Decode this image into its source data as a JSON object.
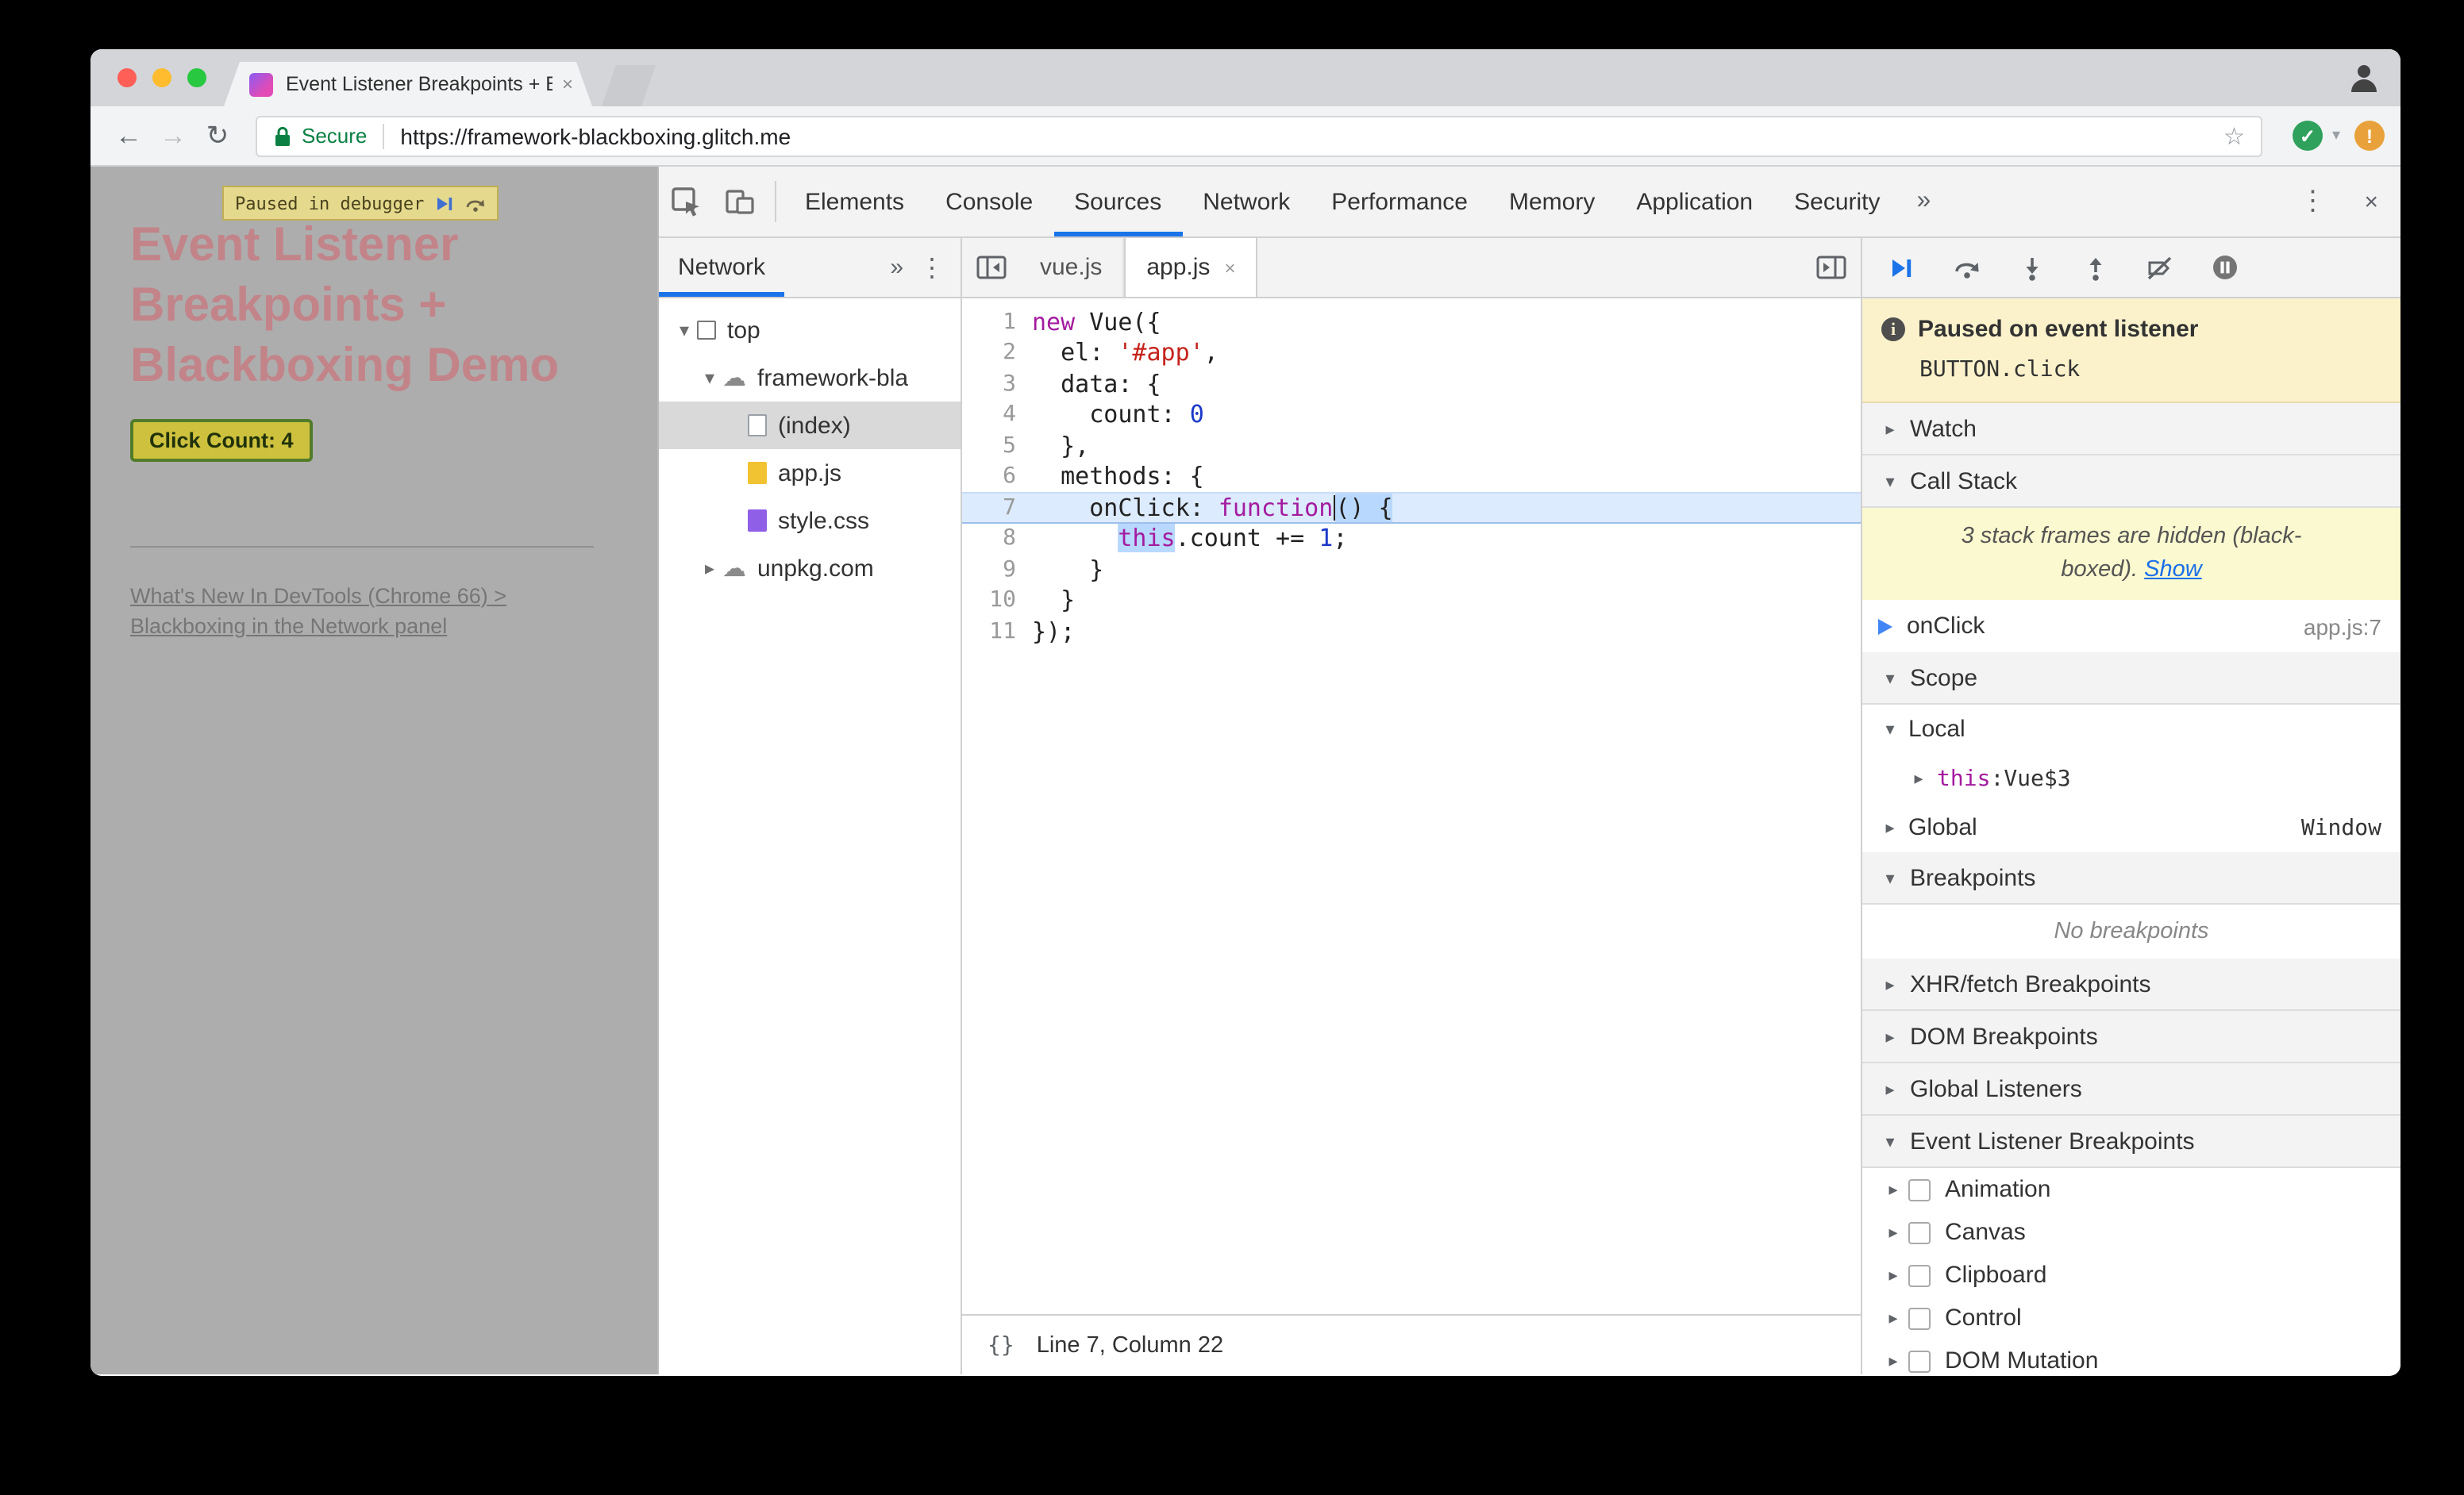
{
  "icons": {
    "back": "←",
    "forward": "→",
    "reload": "↻",
    "star": "☆",
    "kebab": "⋮",
    "close": "×",
    "overflow": "»",
    "tab_close": "×",
    "pretty_print": "{}",
    "cloud": "☁",
    "tri_down": "▾",
    "tri_right": "▸",
    "green_badge": "✓",
    "orange_badge": "!",
    "chevron_down": "▾"
  },
  "browser": {
    "tab_title": "Event Listener Breakpoints + B",
    "secure_label": "Secure",
    "url": "https://framework-blackboxing.glitch.me"
  },
  "page": {
    "paused_banner": "Paused in debugger",
    "heading_lines": [
      "Event Listener",
      "Breakpoints +",
      "Blackboxing Demo"
    ],
    "click_button": "Click Count: 4",
    "link_line1": "What's New In DevTools (Chrome 66) >",
    "link_line2": "Blackboxing in the Network panel"
  },
  "devtools": {
    "tabs": [
      "Elements",
      "Console",
      "Sources",
      "Network",
      "Performance",
      "Memory",
      "Application",
      "Security"
    ],
    "active_tab": "Sources",
    "navigator": {
      "active_tab": "Network",
      "tree": [
        {
          "label": "top",
          "icon": "frame",
          "depth": 0,
          "expander": "down"
        },
        {
          "label": "framework-bla",
          "icon": "cloud",
          "depth": 1,
          "expander": "down"
        },
        {
          "label": "(index)",
          "icon": "doc",
          "depth": 2,
          "expander": null,
          "selected": true
        },
        {
          "label": "app.js",
          "icon": "js",
          "depth": 2,
          "expander": null
        },
        {
          "label": "style.css",
          "icon": "css",
          "depth": 2,
          "expander": null
        },
        {
          "label": "unpkg.com",
          "icon": "cloud",
          "depth": 1,
          "expander": "right"
        }
      ]
    },
    "editor": {
      "tabs": [
        {
          "label": "vue.js",
          "active": false,
          "closable": false
        },
        {
          "label": "app.js",
          "active": true,
          "closable": true
        }
      ],
      "status": "Line 7, Column 22",
      "lines": [
        {
          "n": 1,
          "segs": [
            {
              "t": "new ",
              "c": "kw"
            },
            {
              "t": "Vue({",
              "c": "pln"
            }
          ]
        },
        {
          "n": 2,
          "segs": [
            {
              "t": "  el: ",
              "c": "pln"
            },
            {
              "t": "'#app'",
              "c": "str"
            },
            {
              "t": ",",
              "c": "pln"
            }
          ]
        },
        {
          "n": 3,
          "segs": [
            {
              "t": "  data: {",
              "c": "pln"
            }
          ]
        },
        {
          "n": 4,
          "segs": [
            {
              "t": "    count: ",
              "c": "pln"
            },
            {
              "t": "0",
              "c": "num"
            }
          ]
        },
        {
          "n": 5,
          "segs": [
            {
              "t": "  },",
              "c": "pln"
            }
          ]
        },
        {
          "n": 6,
          "segs": [
            {
              "t": "  methods: {",
              "c": "pln"
            }
          ]
        },
        {
          "n": 7,
          "exec": true,
          "segs": [
            {
              "t": "    onClick: ",
              "c": "pln"
            },
            {
              "t": "function",
              "c": "kw"
            },
            {
              "t": "",
              "c": "caret"
            },
            {
              "t": "() {",
              "c": "pln",
              "sel": true
            }
          ]
        },
        {
          "n": 8,
          "segs": [
            {
              "t": "      ",
              "c": "pln"
            },
            {
              "t": "this",
              "c": "kw",
              "sel": true
            },
            {
              "t": ".count += ",
              "c": "pln"
            },
            {
              "t": "1",
              "c": "num"
            },
            {
              "t": ";",
              "c": "pln"
            }
          ]
        },
        {
          "n": 9,
          "segs": [
            {
              "t": "    }",
              "c": "pln"
            }
          ]
        },
        {
          "n": 10,
          "segs": [
            {
              "t": "  }",
              "c": "pln"
            }
          ]
        },
        {
          "n": 11,
          "segs": [
            {
              "t": "});",
              "c": "pln"
            }
          ]
        }
      ]
    },
    "sidebar": {
      "paused_title": "Paused on event listener",
      "paused_detail": "BUTTON.click",
      "watch_label": "Watch",
      "call_stack": {
        "label": "Call Stack",
        "blackbox_msg_line1": "3 stack frames are hidden (black-",
        "blackbox_msg_line2": "boxed).",
        "show_link": "Show",
        "frame_name": "onClick",
        "frame_location": "app.js:7"
      },
      "scope": {
        "label": "Scope",
        "local_label": "Local",
        "this_name": "this",
        "this_sep": ": ",
        "this_value": "Vue$3",
        "global_label": "Global",
        "global_value": "Window"
      },
      "breakpoints": {
        "label": "Breakpoints",
        "empty": "No breakpoints"
      },
      "xhr_label": "XHR/fetch Breakpoints",
      "dom_label": "DOM Breakpoints",
      "global_listeners_label": "Global Listeners",
      "event_listener": {
        "label": "Event Listener Breakpoints",
        "categories": [
          "Animation",
          "Canvas",
          "Clipboard",
          "Control",
          "DOM Mutation"
        ]
      }
    }
  }
}
